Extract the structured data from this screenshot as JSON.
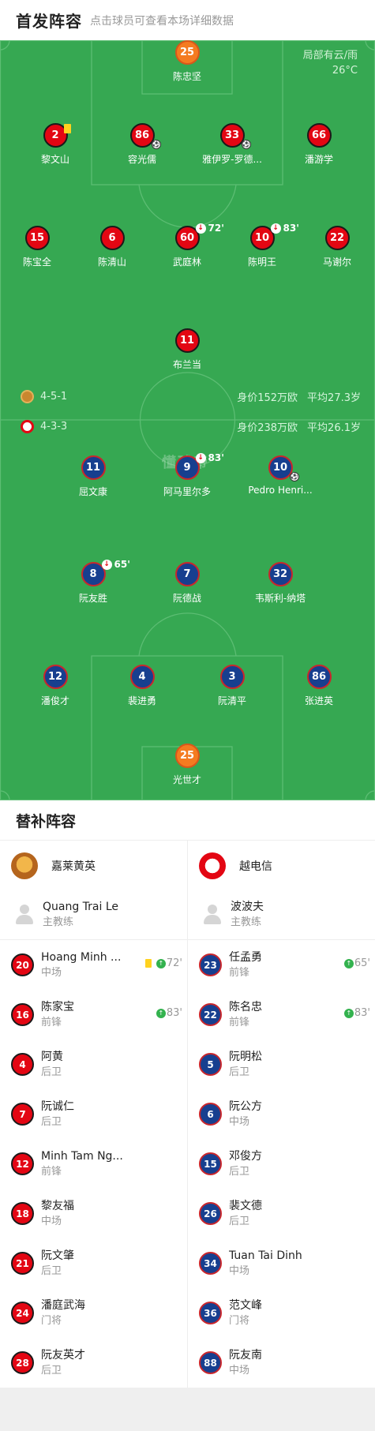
{
  "header": {
    "title": "首发阵容",
    "subtitle": "点击球员可查看本场详细数据"
  },
  "weather": {
    "condition": "局部有云/雨",
    "temperature": "26°C"
  },
  "watermark": "懂球帝",
  "home_team": {
    "formation": "4-5-1",
    "market_value": "身价152万欧",
    "avg_age": "平均27.3岁",
    "players": {
      "gk": {
        "number": "25",
        "name": "陈忠坚"
      },
      "p1": {
        "number": "2",
        "name": "黎文山"
      },
      "p2": {
        "number": "86",
        "name": "容光儒"
      },
      "p3": {
        "number": "33",
        "name": "雅伊罗-罗德..."
      },
      "p4": {
        "number": "66",
        "name": "潘游学"
      },
      "p5": {
        "number": "15",
        "name": "陈宝全"
      },
      "p6": {
        "number": "6",
        "name": "陈清山"
      },
      "p7": {
        "number": "60",
        "name": "武庭林",
        "sub_minute": "72'"
      },
      "p8": {
        "number": "10",
        "name": "陈明王",
        "sub_minute": "83'"
      },
      "p9": {
        "number": "22",
        "name": "马谢尔"
      },
      "p10": {
        "number": "11",
        "name": "布兰当"
      }
    }
  },
  "away_team": {
    "formation": "4-3-3",
    "market_value": "身价238万欧",
    "avg_age": "平均26.1岁",
    "players": {
      "a1": {
        "number": "11",
        "name": "屈文康"
      },
      "a2": {
        "number": "9",
        "name": "阿马里尔多",
        "sub_minute": "83'"
      },
      "a3": {
        "number": "10",
        "name": "Pedro Henri..."
      },
      "a4": {
        "number": "8",
        "name": "阮友胜",
        "sub_minute": "65'"
      },
      "a5": {
        "number": "7",
        "name": "阮德战"
      },
      "a6": {
        "number": "32",
        "name": "韦斯利-纳塔"
      },
      "a7": {
        "number": "12",
        "name": "潘俊才"
      },
      "a8": {
        "number": "4",
        "name": "裴进勇"
      },
      "a9": {
        "number": "3",
        "name": "阮清平"
      },
      "a10": {
        "number": "86",
        "name": "张进英"
      },
      "gk": {
        "number": "25",
        "name": "光世才"
      }
    }
  },
  "subs": {
    "title": "替补阵容",
    "home": {
      "team_name": "嘉莱黄英",
      "coach": {
        "name": "Quang Trai Le",
        "role": "主教练"
      },
      "players": [
        {
          "number": "20",
          "name": "Hoang Minh ...",
          "position": "中场",
          "yellow": true,
          "sub_minute": "72'"
        },
        {
          "number": "16",
          "name": "陈家宝",
          "position": "前锋",
          "sub_minute": "83'"
        },
        {
          "number": "4",
          "name": "阿黄",
          "position": "后卫"
        },
        {
          "number": "7",
          "name": "阮诚仁",
          "position": "后卫"
        },
        {
          "number": "12",
          "name": "Minh Tam Ng...",
          "position": "前锋"
        },
        {
          "number": "18",
          "name": "黎友福",
          "position": "中场"
        },
        {
          "number": "21",
          "name": "阮文肇",
          "position": "后卫"
        },
        {
          "number": "24",
          "name": "潘庭武海",
          "position": "门将"
        },
        {
          "number": "28",
          "name": "阮友英才",
          "position": "后卫"
        }
      ]
    },
    "away": {
      "team_name": "越电信",
      "coach": {
        "name": "波波夫",
        "role": "主教练"
      },
      "players": [
        {
          "number": "23",
          "name": "任孟勇",
          "position": "前锋",
          "sub_minute": "65'"
        },
        {
          "number": "22",
          "name": "陈名忠",
          "position": "前锋",
          "sub_minute": "83'"
        },
        {
          "number": "5",
          "name": "阮明松",
          "position": "后卫"
        },
        {
          "number": "6",
          "name": "阮公方",
          "position": "中场"
        },
        {
          "number": "15",
          "name": "邓俊方",
          "position": "后卫"
        },
        {
          "number": "26",
          "name": "裴文德",
          "position": "后卫"
        },
        {
          "number": "34",
          "name": "Tuan Tai Dinh",
          "position": "中场"
        },
        {
          "number": "36",
          "name": "范文峰",
          "position": "门将"
        },
        {
          "number": "88",
          "name": "阮友南",
          "position": "中场"
        }
      ]
    }
  },
  "colors": {
    "pitch": "#36a852",
    "home": "#e30613",
    "away": "#173f8f",
    "goalkeeper": "#f47b20",
    "yellow_card": "#ffd21f",
    "sub_in": "#33b24e"
  }
}
